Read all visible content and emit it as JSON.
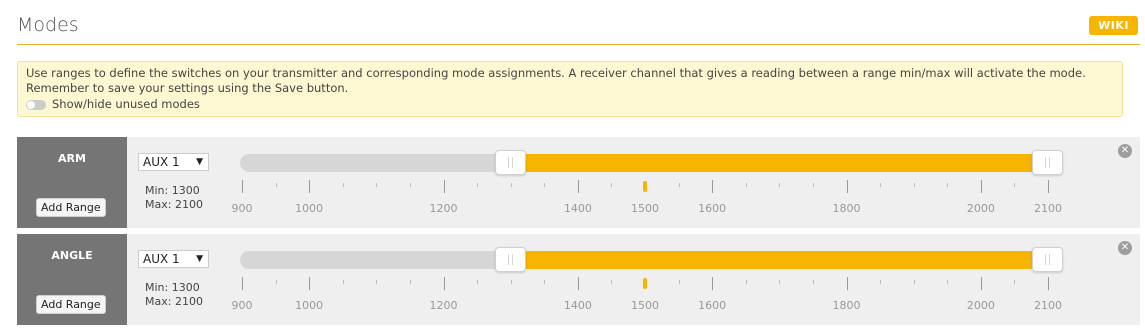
{
  "header": {
    "title": "Modes",
    "wiki_label": "WIKI"
  },
  "note": {
    "text": "Use ranges to define the switches on your transmitter and corresponding mode assignments. A receiver channel that gives a reading between a range min/max will activate the mode. Remember to save your settings using the Save button.",
    "toggle_label": "Show/hide unused modes"
  },
  "colors": {
    "accent": "#f7b400"
  },
  "scale": {
    "min": 900,
    "max": 2100,
    "labels": [
      "900",
      "1000",
      "1200",
      "1400",
      "1500",
      "1600",
      "1800",
      "2000",
      "2100"
    ]
  },
  "modes": [
    {
      "name": "ARM",
      "channel": "AUX 1",
      "min_text": "Min: 1300",
      "max_text": "Max: 2100",
      "min": 1300,
      "max": 2100,
      "marker": 1500,
      "add_range_label": "Add Range"
    },
    {
      "name": "ANGLE",
      "channel": "AUX 1",
      "min_text": "Min: 1300",
      "max_text": "Max: 2100",
      "min": 1300,
      "max": 2100,
      "marker": 1500,
      "add_range_label": "Add Range"
    }
  ]
}
